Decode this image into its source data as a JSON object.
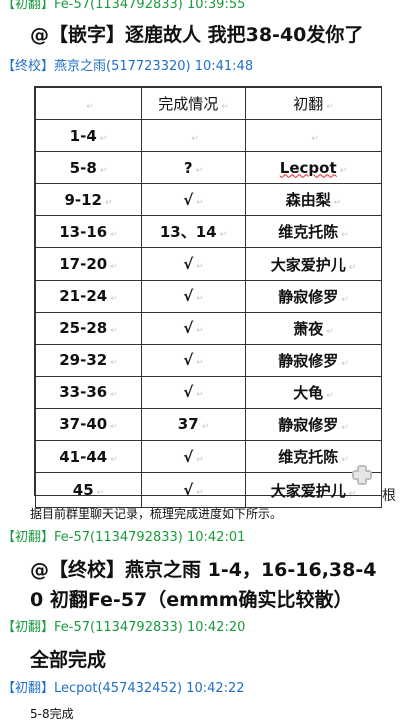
{
  "messages": [
    {
      "sender": "【初翻】Fe-57(1134792833) 10:39:55",
      "color": "green",
      "text": "@【嵌字】逐鹿故人 我把38-40发你了"
    },
    {
      "sender": "【终校】燕京之雨(517723320) 10:41:48",
      "color": "blue"
    },
    {
      "sender": "【初翻】Fe-57(1134792833) 10:42:01",
      "color": "green",
      "text_line1": "@【终校】燕京之雨 1-4，16-16,38-4",
      "text_line2": "0 初翻Fe-57（emmm确实比较散）"
    },
    {
      "sender": "【初翻】Fe-57(1134792833) 10:42:20",
      "color": "green",
      "text": "全部完成"
    },
    {
      "sender": "【初翻】Lecpot(457432452) 10:42:22",
      "color": "blue",
      "text": "5-8完成"
    }
  ],
  "table": {
    "headers": [
      "",
      "完成情况",
      "初翻"
    ],
    "rows": [
      [
        "1-4",
        "",
        ""
      ],
      [
        "5-8",
        "?",
        "Lecpot"
      ],
      [
        "9-12",
        "√",
        "森由梨"
      ],
      [
        "13-16",
        "13、14",
        "维克托陈"
      ],
      [
        "17-20",
        "√",
        "大家爱护儿"
      ],
      [
        "21-24",
        "√",
        "静寂修罗"
      ],
      [
        "25-28",
        "√",
        "萧夜"
      ],
      [
        "29-32",
        "√",
        "静寂修罗"
      ],
      [
        "33-36",
        "√",
        "大龟"
      ],
      [
        "37-40",
        "37",
        "静寂修罗"
      ],
      [
        "41-44",
        "√",
        "维克托陈"
      ],
      [
        "45",
        "√",
        "大家爱护儿"
      ]
    ],
    "paragraph_mark": "↵",
    "trailing_label": "根"
  },
  "caption": "据目前群里聊天记录，梳理完成进度如下所示。"
}
